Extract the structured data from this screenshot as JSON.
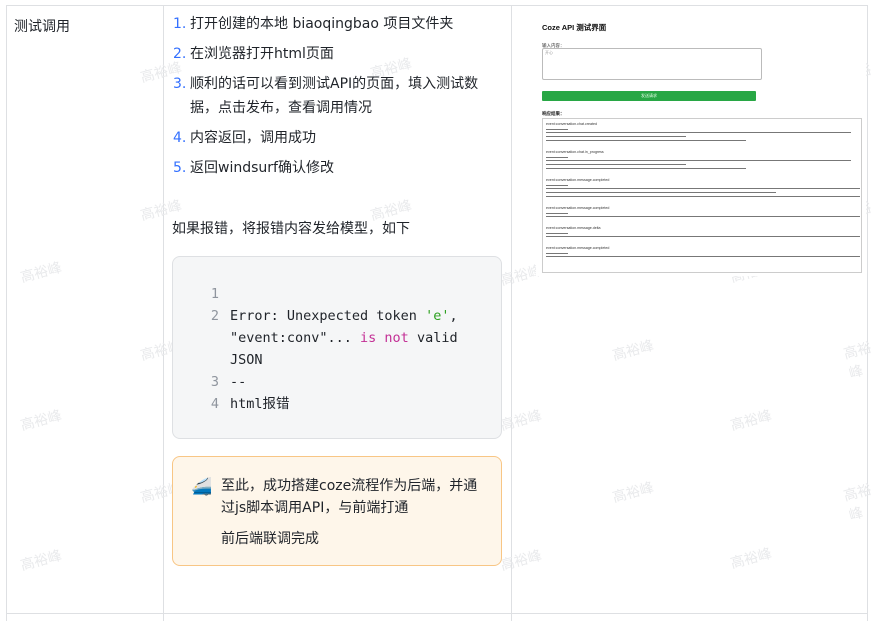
{
  "row_title": "测试调用",
  "steps": [
    {
      "num": "1.",
      "text": "打开创建的本地 biaoqingbao 项目文件夹"
    },
    {
      "num": "2.",
      "text": "在浏览器打开html页面"
    },
    {
      "num": "3.",
      "text": "顺利的话可以看到测试API的页面，填入测试数",
      "text2": "据，点击发布，查看调用情况"
    },
    {
      "num": "4.",
      "text": "内容返回，调用成功"
    },
    {
      "num": "5.",
      "text": "返回windsurf确认修改"
    }
  ],
  "error_hint": "如果报错，将报错内容发给模型，如下",
  "code": {
    "lines": [
      {
        "n": "1",
        "text": ""
      },
      {
        "n": "2",
        "p1": "Error: Unexpected token ",
        "s1": "'e'",
        "p2": ","
      },
      {
        "n": "",
        "p1": "\"event:conv\"... ",
        "k1": "is not",
        "p2": " valid"
      },
      {
        "n": "",
        "p1": "JSON"
      },
      {
        "n": "3",
        "p1": "--"
      },
      {
        "n": "4",
        "p1": "html报错"
      }
    ]
  },
  "callout": {
    "icon": "🚄",
    "line1": "至此，成功搭建coze流程作为后端，并通",
    "line2": "过js脚本调用API，与前端打通",
    "line3": "前后端联调完成"
  },
  "screenshot": {
    "title": "Coze API 测试界面",
    "input_label": "输入内容：",
    "input_placeholder": "开心",
    "submit_label": "发送请求",
    "response_label": "响应结果：",
    "events": [
      "event:conversation.chat.created",
      "event:conversation.chat.in_progress",
      "event:conversation.message.completed",
      "event:conversation.message.completed",
      "event:conversation.message.delta",
      "event:conversation.message.completed"
    ]
  },
  "watermark": "高裕峰"
}
